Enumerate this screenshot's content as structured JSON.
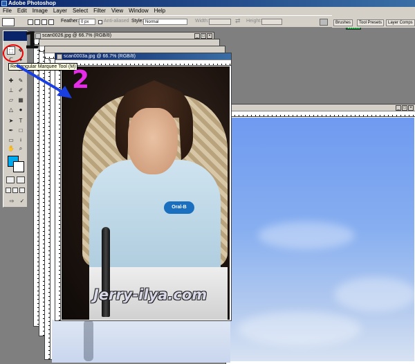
{
  "app": {
    "title": "Adobe Photoshop"
  },
  "menu": [
    "File",
    "Edit",
    "Image",
    "Layer",
    "Select",
    "Filter",
    "View",
    "Window",
    "Help"
  ],
  "options": {
    "feather_label": "Feather:",
    "feather_value": "0 px",
    "anti_aliased_label": "Anti-aliased",
    "style_label": "Style:",
    "style_value": "Normal",
    "width_label": "Width:",
    "height_label": "Height:"
  },
  "palette_well": {
    "tabs": [
      "Brushes",
      "Tool Presets",
      "Layer Comps"
    ]
  },
  "tooltip": "Rectangular Marquee Tool (M)",
  "annotations": {
    "step1": "1",
    "step2": "2"
  },
  "documents": {
    "back_title": "scan0026.jpg @ 66.7% (RGB/8)",
    "front_title": "scan0003a.jpg @ 66.7% (RGB/8)"
  },
  "photo": {
    "badge_text": "Oral-B",
    "watermark": "Jerry-ilya.com"
  },
  "colors": {
    "foreground": "#00aaee",
    "background": "#ffffff",
    "annotation_red": "#e00000",
    "annotation_blue": "#1a3fe0",
    "annotation_magenta": "#e62ce8"
  }
}
